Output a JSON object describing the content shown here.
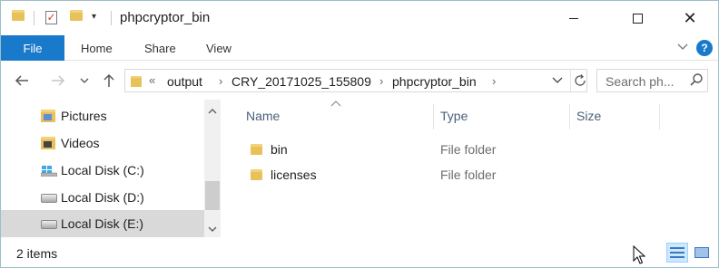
{
  "window": {
    "title": "phpcryptor_bin"
  },
  "ribbon": {
    "tabs": [
      {
        "label": "File"
      },
      {
        "label": "Home"
      },
      {
        "label": "Share"
      },
      {
        "label": "View"
      }
    ],
    "help": "?"
  },
  "address_bar": {
    "overflow": "«",
    "crumbs": [
      "output",
      "CRY_20171025_155809",
      "phpcryptor_bin"
    ]
  },
  "search": {
    "placeholder": "Search ph..."
  },
  "nav_pane": {
    "items": [
      {
        "label": "Pictures",
        "icon": "pictures-folder-icon"
      },
      {
        "label": "Videos",
        "icon": "videos-folder-icon"
      },
      {
        "label": "Local Disk (C:)",
        "icon": "windows-drive-icon"
      },
      {
        "label": "Local Disk (D:)",
        "icon": "drive-icon"
      },
      {
        "label": "Local Disk (E:)",
        "icon": "drive-icon",
        "selected": true
      }
    ]
  },
  "file_list": {
    "columns": [
      "Name",
      "Type",
      "Size"
    ],
    "rows": [
      {
        "name": "bin",
        "type": "File folder",
        "size": ""
      },
      {
        "name": "licenses",
        "type": "File folder",
        "size": ""
      }
    ]
  },
  "status": {
    "item_count": "2 items"
  },
  "colors": {
    "file_tab": "#1979ca",
    "folder": "#e8c15a",
    "selected_row": "#d9d9d9",
    "column_header_text": "#4c607a"
  }
}
